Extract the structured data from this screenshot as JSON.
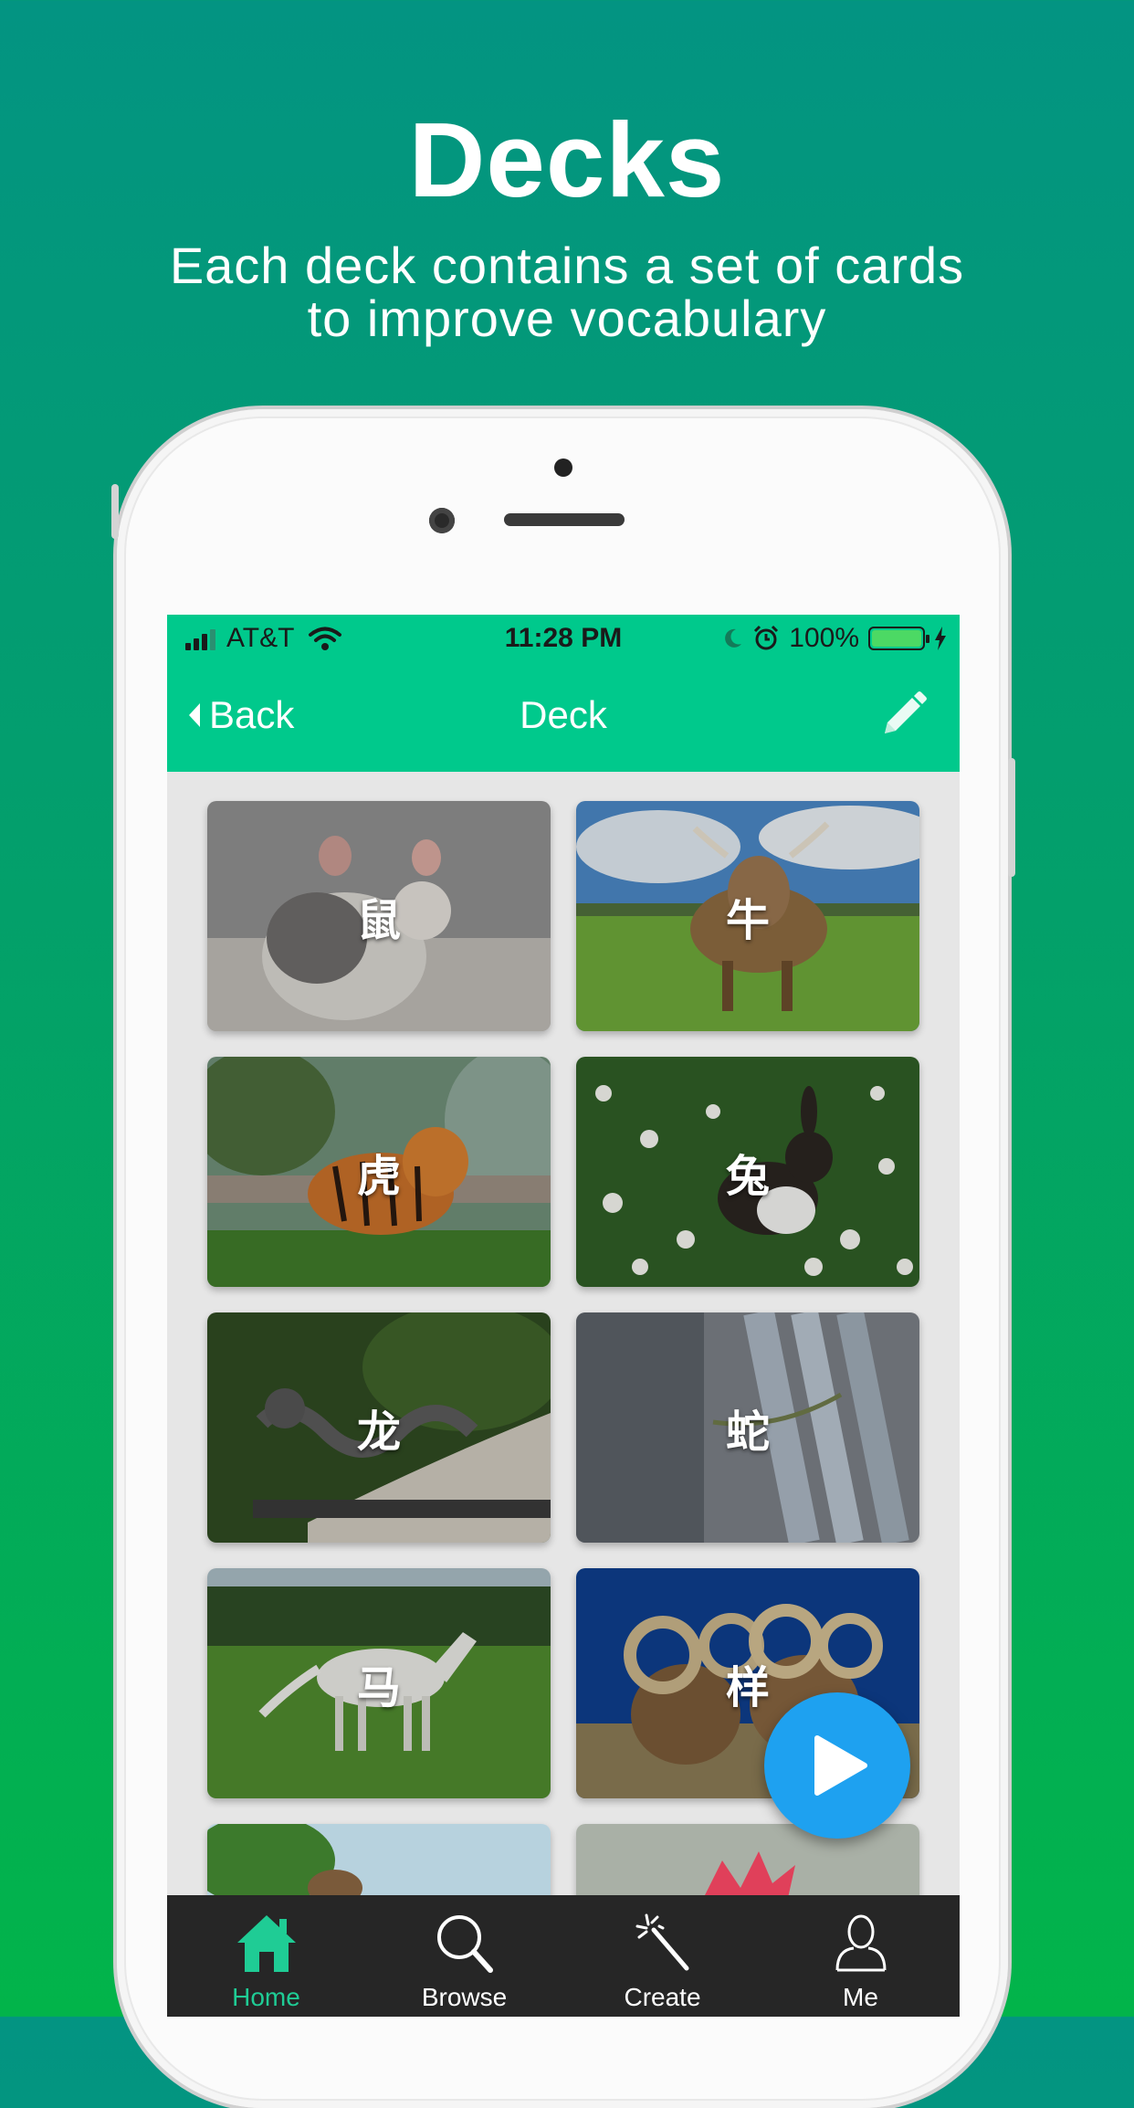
{
  "promo": {
    "title": "Decks",
    "subtitle": "Each deck contains a set of cards\nto improve vocabulary"
  },
  "status_bar": {
    "carrier": "AT&T",
    "time": "11:28 PM",
    "battery_percent": "100%",
    "battery_level": 1.0,
    "icons": [
      "signal-icon",
      "wifi-icon",
      "moon-icon",
      "alarm-icon",
      "battery-icon",
      "charging-icon"
    ]
  },
  "nav": {
    "back_label": "Back",
    "title": "Deck",
    "edit_icon": "pencil-icon"
  },
  "cards": [
    {
      "label": "鼠",
      "image": "rat photo"
    },
    {
      "label": "牛",
      "image": "cow photo"
    },
    {
      "label": "虎",
      "image": "tiger photo"
    },
    {
      "label": "兔",
      "image": "rabbit photo"
    },
    {
      "label": "龙",
      "image": "dragon statue photo"
    },
    {
      "label": "蛇",
      "image": "snake on branches photo"
    },
    {
      "label": "马",
      "image": "white horse photo"
    },
    {
      "label": "样",
      "image": "ram photo"
    },
    {
      "label": "",
      "image": "partially visible photo"
    },
    {
      "label": "",
      "image": "partially visible photo"
    }
  ],
  "fab": {
    "icon": "play-icon"
  },
  "tabs": [
    {
      "label": "Home",
      "icon": "home-icon",
      "active": true
    },
    {
      "label": "Browse",
      "icon": "search-icon",
      "active": false
    },
    {
      "label": "Create",
      "icon": "magic-wand-icon",
      "active": false
    },
    {
      "label": "Me",
      "icon": "person-icon",
      "active": false
    }
  ],
  "colors": {
    "accent": "#00c98c",
    "tab_active": "#1fcc95",
    "fab": "#1ea1f0",
    "tabbar": "#262626"
  }
}
